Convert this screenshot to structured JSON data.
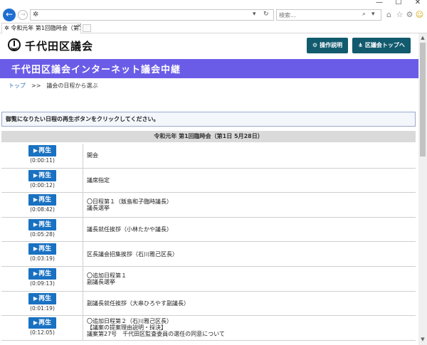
{
  "browser": {
    "window_controls": [
      "—",
      "☐",
      "✕"
    ],
    "back_icon": "arrow-left-icon",
    "address": "",
    "search_placeholder": "検索...",
    "tab_title": "令和元年 第1回臨時会（第…",
    "toolbar_icons": [
      "home-icon",
      "star-icon",
      "gear-icon",
      "smiley-icon"
    ]
  },
  "site": {
    "logo_text": "千代田区議会",
    "header_buttons": [
      {
        "label": "操作説明",
        "icon": "gear-icon"
      },
      {
        "label": "区議会トップへ",
        "icon": "tree-icon"
      }
    ],
    "banner_title": "千代田区議会インターネット議会中継"
  },
  "breadcrumb": {
    "home": "トップ",
    "separator": ">>",
    "current": "議会の日程から選ぶ"
  },
  "instruction": "御覧になりたい日程の再生ボタンをクリックしてください。",
  "meeting_title": "令和元年 第1回臨時会（第1日 5月28日）",
  "play_label": "再生",
  "colors": {
    "banner": "#6b5ce7",
    "header_button": "#125a6e",
    "play_button": "#1971c2"
  },
  "items": [
    {
      "duration": "(0:00:11)",
      "description": "開会"
    },
    {
      "duration": "(0:00:12)",
      "description": "議席指定"
    },
    {
      "duration": "(0:08:42)",
      "description": "〇日程第１（飯島和子臨時議長）\n議長選挙"
    },
    {
      "duration": "(0:05:28)",
      "description": "議長就任挨拶（小林たかや議長）"
    },
    {
      "duration": "(0:03:19)",
      "description": "区長議会招集挨拶（石川雅己区長）"
    },
    {
      "duration": "(0:09:13)",
      "description": "〇追加日程第１\n副議長選挙"
    },
    {
      "duration": "(0:01:19)",
      "description": "副議長就任挨拶（大串ひろやす副議長）"
    },
    {
      "duration": "(0:12:05)",
      "description": "〇追加日程第２（石川雅己区長）\n【議案の提案理由説明・採決】\n議案第27号　千代田区監査委員の選任の同意について"
    }
  ]
}
